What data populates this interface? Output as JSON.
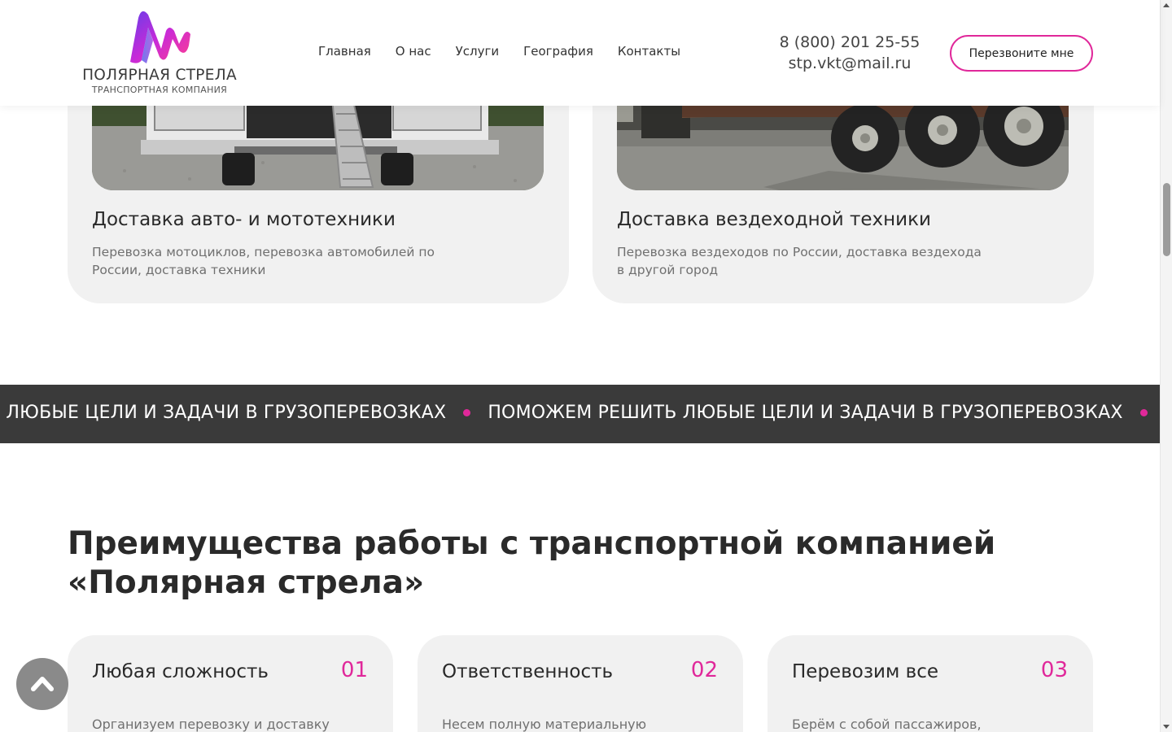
{
  "brand": {
    "name": "ПОЛЯРНАЯ СТРЕЛА",
    "tagline": "ТРАНСПОРТНАЯ КОМПАНИЯ",
    "accent_color": "#e0289a",
    "logo_icon": "logo-m-icon"
  },
  "nav": {
    "items": [
      {
        "label": "Главная"
      },
      {
        "label": "О нас"
      },
      {
        "label": "Услуги"
      },
      {
        "label": "География"
      },
      {
        "label": "Контакты"
      }
    ]
  },
  "contacts": {
    "phone": "8 (800) 201 25-55",
    "email": "stp.vkt@mail.ru"
  },
  "header": {
    "callback_label": "Перезвоните мне"
  },
  "services": [
    {
      "title": "Доставка авто- и мототехники",
      "description": "Перевозка мотоциклов, перевозка автомобилей по России, доставка техники",
      "photo": "van-with-ramp-photo"
    },
    {
      "title": "Доставка вездеходной техники",
      "description": "Перевозка вездеходов по России, доставка вездехода в другой город",
      "photo": "lowboy-trailer-photo"
    }
  ],
  "marquee": {
    "text": "ПОМОЖЕМ РЕШИТЬ ЛЮБЫЕ ЦЕЛИ И ЗАДАЧИ В ГРУЗОПЕРЕВОЗКАХ",
    "background": "#3a3a3a"
  },
  "advantages": {
    "heading_bold": "Преимущества работы",
    "heading_rest": "с транспортной компанией «Полярная стрела»",
    "cards": [
      {
        "title": "Любая сложность",
        "number": "01",
        "text": "Организуем перевозку и доставку"
      },
      {
        "title": "Ответственность",
        "number": "02",
        "text": "Несем полную материальную"
      },
      {
        "title": "Перевозим все",
        "number": "03",
        "text": "Берём с собой пассажиров,"
      }
    ]
  },
  "back_to_top": {
    "icon": "chevron-up-icon"
  }
}
